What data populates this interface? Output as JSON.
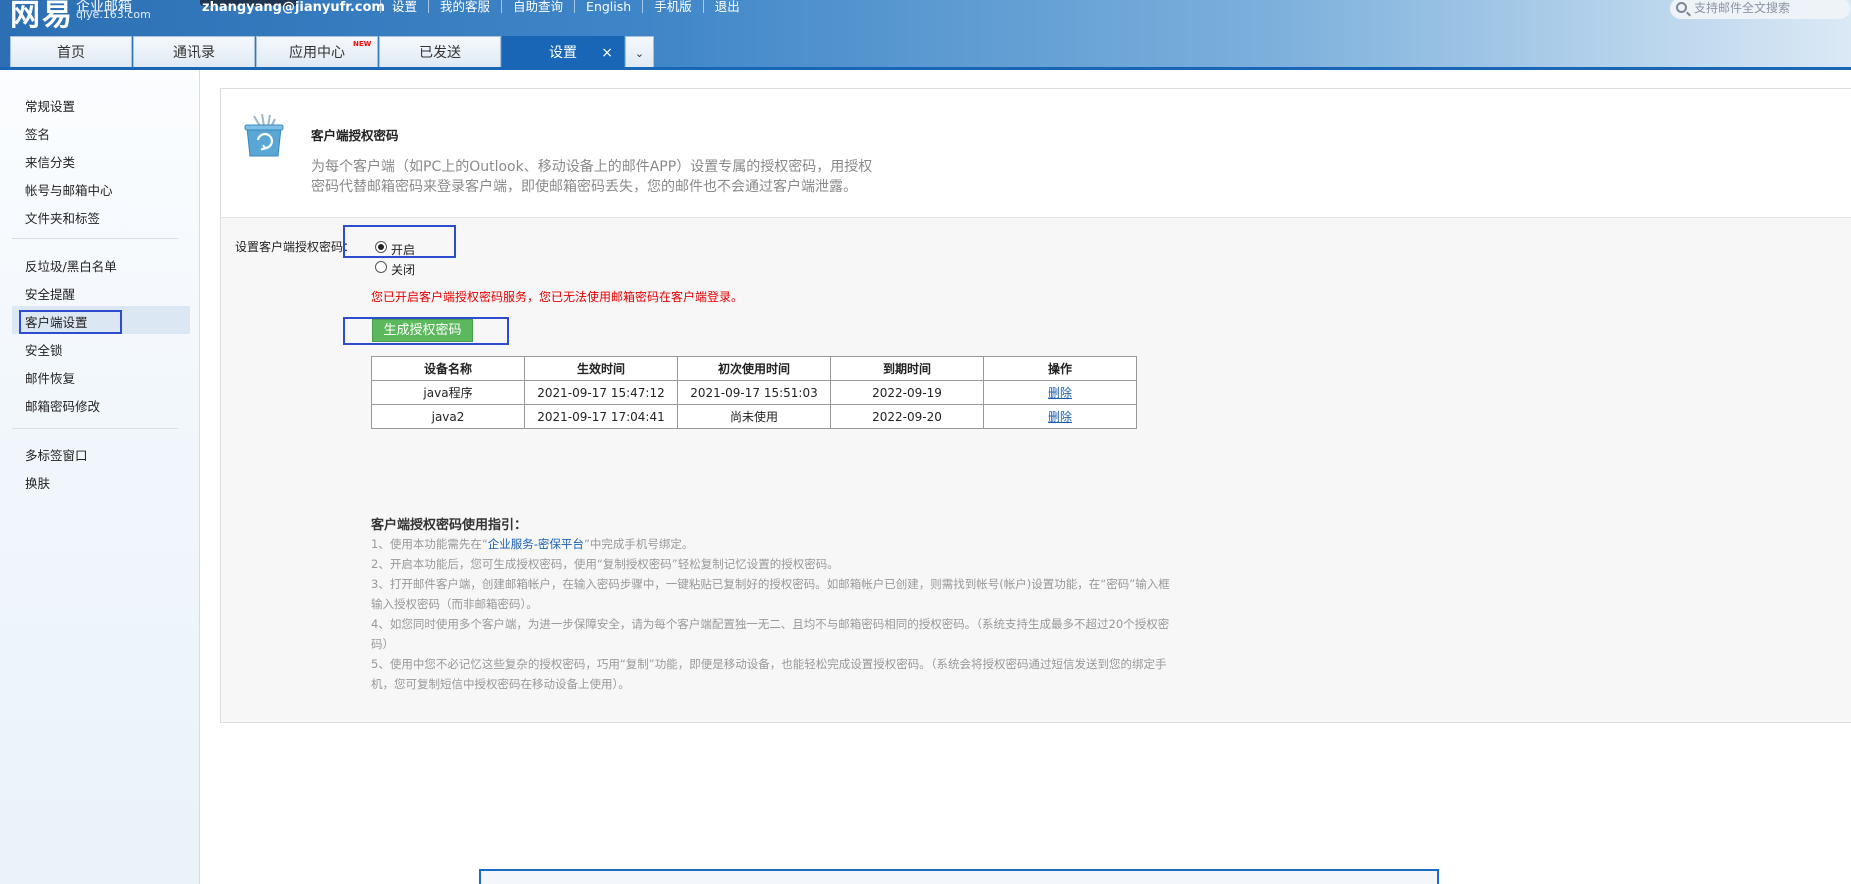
{
  "header": {
    "logo": "网易",
    "logo_sub": "企业邮箱",
    "logo_domain": "qiye.163.com",
    "user_email": "zhangyang@jianyufr.com",
    "top_links": [
      "设置",
      "我的客服",
      "自助查询",
      "English",
      "手机版",
      "退出"
    ],
    "search_placeholder": "支持邮件全文搜索"
  },
  "tabs": [
    {
      "label": "首页"
    },
    {
      "label": "通讯录"
    },
    {
      "label": "应用中心",
      "badge": "NEW"
    },
    {
      "label": "已发送"
    },
    {
      "label": "设置",
      "active": true,
      "close": "×"
    }
  ],
  "tab_more": "⌄",
  "sidebar": {
    "group1": [
      "常规设置",
      "签名",
      "来信分类",
      "帐号与邮箱中心",
      "文件夹和标签"
    ],
    "group2": [
      "反垃圾/黑白名单",
      "安全提醒",
      "客户端设置",
      "安全锁",
      "邮件恢复",
      "邮箱密码修改"
    ],
    "group3": [
      "多标签窗口",
      "换肤"
    ],
    "active": "客户端设置"
  },
  "content": {
    "title": "客户端授权密码",
    "description": "为每个客户端（如PC上的Outlook、移动设备上的邮件APP）设置专属的授权密码，用授权密码代替邮箱密码来登录客户端，即使邮箱密码丢失，您的邮件也不会通过客户端泄露。",
    "setting_label": "设置客户端授权密码：",
    "option_on": "开启",
    "option_off": "关闭",
    "selected": "开启",
    "warning": "您已开启客户端授权密码服务，您已无法使用邮箱密码在客户端登录。",
    "generate_button": "生成授权密码",
    "table": {
      "headers": [
        "设备名称",
        "生效时间",
        "初次使用时间",
        "到期时间",
        "操作"
      ],
      "rows": [
        [
          "java程序",
          "2021-09-17 15:47:12",
          "2021-09-17 15:51:03",
          "2022-09-19",
          "删除"
        ],
        [
          "java2",
          "2021-09-17 17:04:41",
          "尚未使用",
          "2022-09-20",
          "删除"
        ]
      ]
    },
    "guide_title": "客户端授权密码使用指引：",
    "guide": {
      "l1_prefix": "1、使用本功能需先在“",
      "l1_link": "企业服务-密保平台",
      "l1_suffix": "”中完成手机号绑定。",
      "l2": "2、开启本功能后，您可生成授权密码，使用“复制授权密码”轻松复制记忆设置的授权密码。",
      "l3": "3、打开邮件客户端，创建邮箱帐户，在输入密码步骤中，一键粘贴已复制好的授权密码。如邮箱帐户已创建，则需找到帐号(帐户)设置功能，在“密码”输入框输入授权密码（而非邮箱密码）。",
      "l4": "4、如您同时使用多个客户端，为进一步保障安全，请为每个客户端配置独一无二、且均不与邮箱密码相同的授权密码。（系统支持生成最多不超过20个授权密码）",
      "l5": "5、使用中您不必记忆这些复杂的授权密码，巧用“复制”功能，即便是移动设备，也能轻松完成设置授权密码。（系统会将授权密码通过短信发送到您的绑定手机，您可复制短信中授权密码在移动设备上使用）。"
    }
  },
  "icons": {
    "trash": "recycle-bin-icon",
    "search": "search-icon"
  },
  "colors": {
    "brand_blue": "#1866b5",
    "annotation_blue": "#2d4ccd",
    "warning_red": "#e60000",
    "button_green": "#5cb85c",
    "link_blue": "#1a5fb4"
  }
}
